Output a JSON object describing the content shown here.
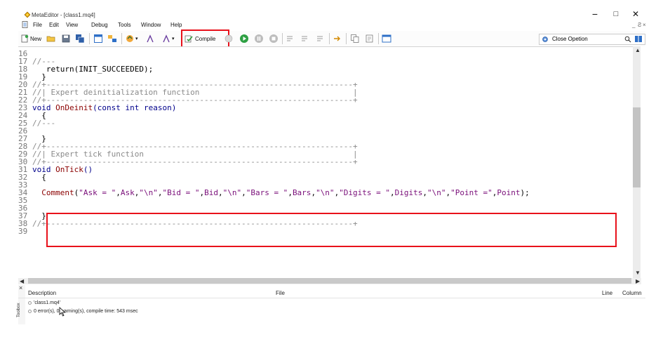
{
  "window": {
    "title": "MetaEditor - [class1.mq4]",
    "minimize": "−",
    "maximize": "□",
    "close": "✕"
  },
  "menu": {
    "items": [
      "File",
      "Edit",
      "View",
      "Debug",
      "Tools",
      "Window",
      "Help"
    ],
    "mdi_minimize": "_",
    "mdi_restore": "Ƨ",
    "mdi_close": "×"
  },
  "toolbar": {
    "new_label": "New",
    "compile_label": "Compile",
    "search_value": "Close Opetion"
  },
  "editor": {
    "lines": [
      {
        "n": "16",
        "parts": []
      },
      {
        "n": "17",
        "parts": [
          {
            "t": "//---",
            "c": "c-cm"
          }
        ]
      },
      {
        "n": "18",
        "parts": [
          {
            "t": "   return(INIT_SUCCEEDED);",
            "c": "c-blk"
          }
        ]
      },
      {
        "n": "19",
        "parts": [
          {
            "t": "  }",
            "c": "c-blk"
          }
        ]
      },
      {
        "n": "20",
        "parts": [
          {
            "t": "//+------------------------------------------------------------------+",
            "c": "c-cm"
          }
        ]
      },
      {
        "n": "21",
        "parts": [
          {
            "t": "//| Expert deinitialization function                                 |",
            "c": "c-cm"
          }
        ]
      },
      {
        "n": "22",
        "parts": [
          {
            "t": "//+------------------------------------------------------------------+",
            "c": "c-cm"
          }
        ]
      },
      {
        "n": "23",
        "parts": [
          {
            "t": "void ",
            "c": "c-kw"
          },
          {
            "t": "OnDeinit",
            "c": "c-fn"
          },
          {
            "t": "(const int reason)",
            "c": "c-kw"
          }
        ]
      },
      {
        "n": "24",
        "parts": [
          {
            "t": "  {",
            "c": "c-blk"
          }
        ]
      },
      {
        "n": "25",
        "parts": [
          {
            "t": "//---",
            "c": "c-cm"
          }
        ]
      },
      {
        "n": "26",
        "parts": []
      },
      {
        "n": "27",
        "parts": [
          {
            "t": "  }",
            "c": "c-blk"
          }
        ]
      },
      {
        "n": "28",
        "parts": [
          {
            "t": "//+------------------------------------------------------------------+",
            "c": "c-cm"
          }
        ]
      },
      {
        "n": "29",
        "parts": [
          {
            "t": "//| Expert tick function                                             |",
            "c": "c-cm"
          }
        ]
      },
      {
        "n": "30",
        "parts": [
          {
            "t": "//+------------------------------------------------------------------+",
            "c": "c-cm"
          }
        ]
      },
      {
        "n": "31",
        "parts": [
          {
            "t": "void ",
            "c": "c-kw"
          },
          {
            "t": "OnTick",
            "c": "c-fn"
          },
          {
            "t": "()",
            "c": "c-kw"
          }
        ]
      },
      {
        "n": "32",
        "parts": [
          {
            "t": "  {",
            "c": "c-blk"
          }
        ]
      },
      {
        "n": "33",
        "parts": []
      },
      {
        "n": "34",
        "parts": [
          {
            "t": "  Comment",
            "c": "c-fn"
          },
          {
            "t": "(",
            "c": "c-blk"
          },
          {
            "t": "\"Ask = \"",
            "c": "c-str"
          },
          {
            "t": ",",
            "c": "c-blk"
          },
          {
            "t": "Ask",
            "c": "c-id"
          },
          {
            "t": ",",
            "c": "c-blk"
          },
          {
            "t": "\"\\n\"",
            "c": "c-str"
          },
          {
            "t": ",",
            "c": "c-blk"
          },
          {
            "t": "\"Bid = \"",
            "c": "c-str"
          },
          {
            "t": ",",
            "c": "c-blk"
          },
          {
            "t": "Bid",
            "c": "c-id"
          },
          {
            "t": ",",
            "c": "c-blk"
          },
          {
            "t": "\"\\n\"",
            "c": "c-str"
          },
          {
            "t": ",",
            "c": "c-blk"
          },
          {
            "t": "\"Bars = \"",
            "c": "c-str"
          },
          {
            "t": ",",
            "c": "c-blk"
          },
          {
            "t": "Bars",
            "c": "c-id"
          },
          {
            "t": ",",
            "c": "c-blk"
          },
          {
            "t": "\"\\n\"",
            "c": "c-str"
          },
          {
            "t": ",",
            "c": "c-blk"
          },
          {
            "t": "\"Digits = \"",
            "c": "c-str"
          },
          {
            "t": ",",
            "c": "c-blk"
          },
          {
            "t": "Digits",
            "c": "c-id"
          },
          {
            "t": ",",
            "c": "c-blk"
          },
          {
            "t": "\"\\n\"",
            "c": "c-str"
          },
          {
            "t": ",",
            "c": "c-blk"
          },
          {
            "t": "\"Point =\"",
            "c": "c-str"
          },
          {
            "t": ",",
            "c": "c-blk"
          },
          {
            "t": "Point",
            "c": "c-id"
          },
          {
            "t": ");",
            "c": "c-blk"
          }
        ]
      },
      {
        "n": "35",
        "parts": []
      },
      {
        "n": "36",
        "parts": []
      },
      {
        "n": "37",
        "parts": [
          {
            "t": "  }",
            "c": "c-blk"
          }
        ]
      },
      {
        "n": "38",
        "parts": [
          {
            "t": "//+------------------------------------------------------------------+",
            "c": "c-cm"
          }
        ]
      },
      {
        "n": "39",
        "parts": []
      }
    ]
  },
  "output": {
    "col_description": "Description",
    "col_file": "File",
    "col_line": "Line",
    "col_column": "Column",
    "row1": "'class1.mq4'",
    "row2": "0 error(s), 0 warning(s), compile time: 543 msec",
    "close_x": "×",
    "side_label": "Toolbox"
  },
  "colors": {
    "highlight_box": "#e8111b",
    "keyword": "#00008b",
    "function": "#8b0000",
    "string": "#7a0f7a",
    "comment": "#8a8a8a"
  }
}
